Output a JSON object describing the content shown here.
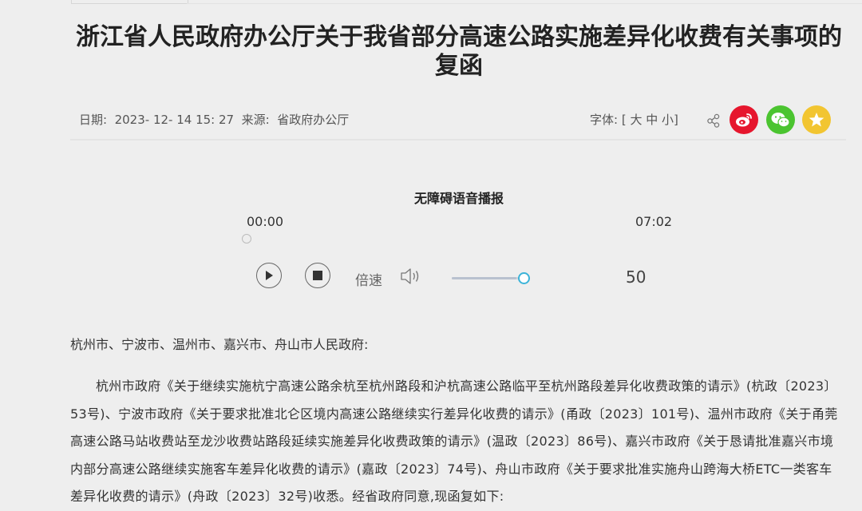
{
  "article": {
    "title": "浙江省人民政府办公厅关于我省部分高速公路实施差异化收费有关事项的复函",
    "meta_text": "日期:  2023- 12- 14 15: 27  来源:  省政府办公厅",
    "font_size_text": "字体: [ 大 中 小]"
  },
  "share": {
    "icons": [
      "share-icon",
      "weibo-icon",
      "wechat-icon",
      "favorite-icon"
    ],
    "colors": {
      "weibo": "#e6162d",
      "wechat": "#4bc430",
      "favorite": "#f2c531"
    }
  },
  "player": {
    "title": "无障碍语音播报",
    "current_time": "00:00",
    "total_time": "07:02",
    "progress": 0,
    "speed_label": "倍速",
    "volume": 50,
    "volume_display": "50",
    "accent_color": "#3bb3d8"
  },
  "content": {
    "addressee": "杭州市、宁波市、温州市、嘉兴市、舟山市人民政府:",
    "paragraph": "杭州市政府《关于继续实施杭宁高速公路余杭至杭州路段和沪杭高速公路临平至杭州路段差异化收费政策的请示》(杭政〔2023〕53号)、宁波市政府《关于要求批准北仑区境内高速公路继续实行差异化收费的请示》(甬政〔2023〕101号)、温州市政府《关于甬莞高速公路马站收费站至龙沙收费站路段延续实施差异化收费政策的请示》(温政〔2023〕86号)、嘉兴市政府《关于恳请批准嘉兴市境内部分高速公路继续实施客车差异化收费的请示》(嘉政〔2023〕74号)、舟山市政府《关于要求批准实施舟山跨海大桥ETC一类客车差异化收费的请示》(舟政〔2023〕32号)收悉。经省政府同意,现函复如下:"
  }
}
